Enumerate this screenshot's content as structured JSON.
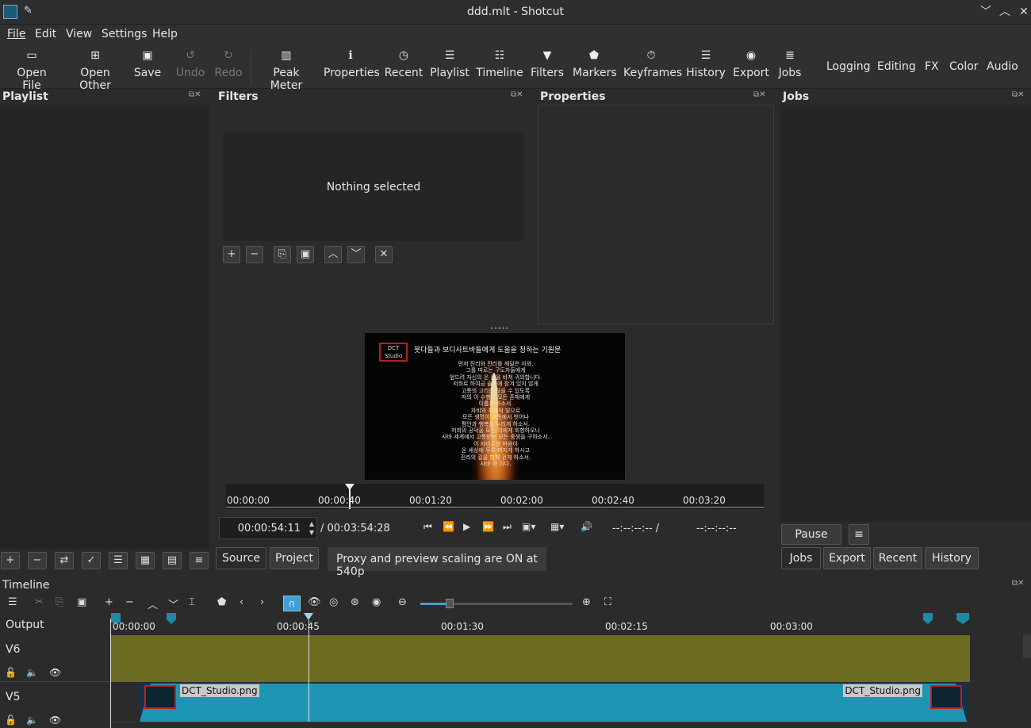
{
  "window": {
    "title": "ddd.mlt - Shotcut"
  },
  "menu": [
    "File",
    "Edit",
    "View",
    "Settings",
    "Help"
  ],
  "toolbar": {
    "open_file": "Open File",
    "open_other": "Open Other",
    "save": "Save",
    "undo": "Undo",
    "redo": "Redo",
    "peak_meter": "Peak Meter",
    "properties": "Properties",
    "recent": "Recent",
    "playlist": "Playlist",
    "timeline": "Timeline",
    "filters": "Filters",
    "markers": "Markers",
    "keyframes": "Keyframes",
    "history": "History",
    "export": "Export",
    "jobs": "Jobs"
  },
  "workspaces": [
    "Logging",
    "Editing",
    "FX",
    "Color",
    "Audio"
  ],
  "panels": {
    "playlist": "Playlist",
    "filters": "Filters",
    "properties": "Properties",
    "jobs": "Jobs",
    "timeline": "Timeline"
  },
  "filters": {
    "empty_text": "Nothing selected"
  },
  "player": {
    "current_time": "00:00:54:11",
    "duration": "/ 00:03:54:28",
    "in_out": "--:--:--:-- /",
    "in_out2": "--:--:--:--",
    "ruler": [
      "00:00:00",
      "00:00:40",
      "00:01:20",
      "00:02:00",
      "00:02:40",
      "00:03:20"
    ],
    "source_tab": "Source",
    "project_tab": "Project",
    "status": "Proxy and preview scaling are ON at 540p",
    "preview_title": "붓다들과 보디사트바들에게 도움을 청하는 기원문",
    "preview_lines": [
      "먼저 진리와 진리를 깨달은 자와,",
      "그를 따르는 구도자들에게",
      "엎드려 자신의 온 몸을 바쳐 귀의합니다.",
      "저희로 하여금 슬픔에 잠겨 있지 않게",
      "고통의 고리를 끊을 수 있도록",
      "저의 이 수행이 모든 존재에게",
      "이롭게 하소서.",
      "자비와 지혜의 빛으로",
      "모든 생명이 고통에서 벗어나",
      "평안과 행복을 누리게 하소서.",
      "저희의 공덕을 모든 이에게 회향하오니",
      "사바 세계에서 고통받는 모든 중생을 구하소서.",
      "이 자비로운 마음이",
      "온 세상에 두루 퍼지게 하시고",
      "진리의 길을 함께 걷게 하소서.",
      "사바 하 이다."
    ],
    "logo_text": "DCT Studio"
  },
  "jobs": {
    "pause": "Pause",
    "tabs": [
      "Jobs",
      "Export",
      "Recent",
      "History"
    ]
  },
  "timeline": {
    "output_label": "Output",
    "ruler": [
      "00:00:00",
      "00:00:45",
      "00:01:30",
      "00:02:15",
      "00:03:00"
    ],
    "tracks": [
      {
        "name": "V6"
      },
      {
        "name": "V5"
      }
    ],
    "clip_name_left": "DCT_Studio.png",
    "clip_name_right": "DCT_Studio.png"
  },
  "colors": {
    "track_v6": "#6b6b22",
    "clip": "#1f95b4",
    "accent": "#3f9fd6"
  }
}
